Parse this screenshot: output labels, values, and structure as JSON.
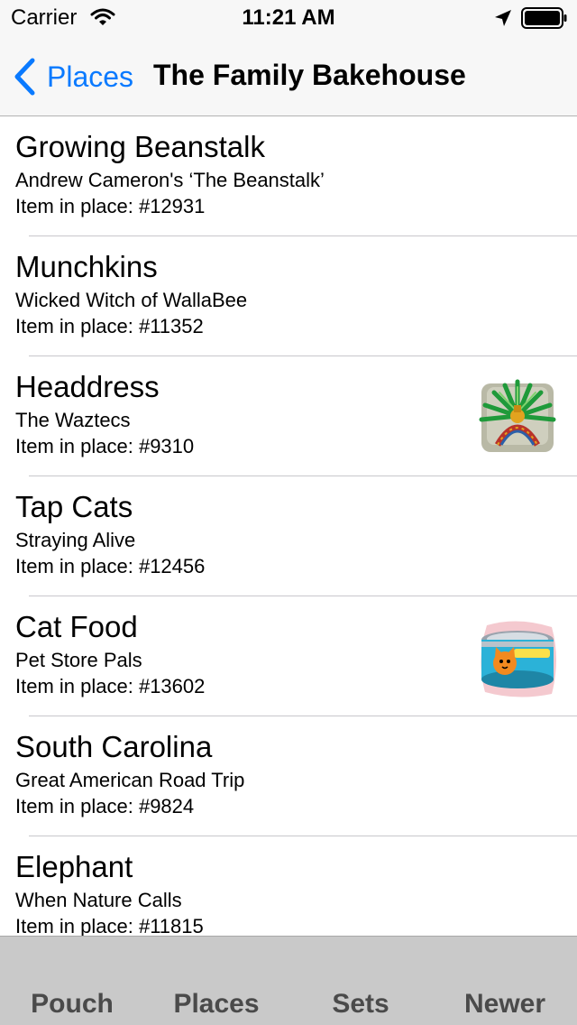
{
  "status_bar": {
    "carrier": "Carrier",
    "time": "11:21 AM",
    "icons": [
      "wifi-icon",
      "location-arrow-icon",
      "battery-icon"
    ]
  },
  "nav": {
    "back_label": "Places",
    "title": "The Family Bakehouse",
    "accent_color": "#0a7aff"
  },
  "items": [
    {
      "title": "Growing Beanstalk",
      "set": "Andrew Cameron's ‘The Beanstalk’",
      "number": "Item in place: #12931",
      "thumb": ""
    },
    {
      "title": "Munchkins",
      "set": "Wicked Witch of WallaBee",
      "number": "Item in place: #11352",
      "thumb": ""
    },
    {
      "title": "Headdress",
      "set": "The Waztecs",
      "number": "Item in place: #9310",
      "thumb": "headdress-thumbnail"
    },
    {
      "title": "Tap Cats",
      "set": "Straying Alive",
      "number": "Item in place: #12456",
      "thumb": ""
    },
    {
      "title": "Cat Food",
      "set": "Pet Store Pals",
      "number": "Item in place: #13602",
      "thumb": "cat-food-thumbnail"
    },
    {
      "title": "South Carolina",
      "set": "Great American Road Trip",
      "number": "Item in place: #9824",
      "thumb": ""
    },
    {
      "title": "Elephant",
      "set": "When Nature Calls",
      "number": "Item in place: #11815",
      "thumb": ""
    }
  ],
  "tabs": [
    {
      "label": "Pouch"
    },
    {
      "label": "Places"
    },
    {
      "label": "Sets"
    },
    {
      "label": "Newer"
    }
  ]
}
